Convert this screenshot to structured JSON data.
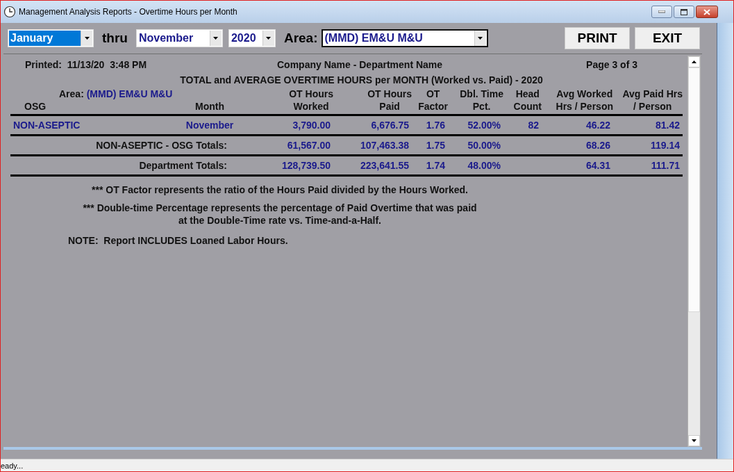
{
  "window": {
    "title": "Management Analysis Reports - Overtime Hours per Month"
  },
  "filters": {
    "from_month": {
      "value": "January",
      "focused": true
    },
    "thru_label": "thru",
    "to_month": {
      "value": "November",
      "focused": false
    },
    "year": {
      "value": "2020",
      "focused": false
    },
    "area_label": "Area:",
    "area": {
      "value": "(MMD) EM&U M&U",
      "focused": false
    }
  },
  "buttons": [
    "PRINT",
    "EXIT"
  ],
  "report": {
    "printed_label": "Printed:",
    "printed_value": "11/13/20  3:48 PM",
    "company": "Company Name - Department Name",
    "page": "Page 3 of 3",
    "title": "TOTAL and AVERAGE OVERTIME HOURS per MONTH (Worked vs. Paid) - 2020",
    "area_label": "Area:",
    "area_value": "(MMD) EM&U M&U",
    "columns": [
      [
        "OSG"
      ],
      [
        "Month"
      ],
      [
        "OT Hours",
        "Worked"
      ],
      [
        "OT Hours",
        "Paid"
      ],
      [
        "OT",
        "Factor"
      ],
      [
        "Dbl. Time",
        "Pct."
      ],
      [
        "Head",
        "Count"
      ],
      [
        "Avg Worked",
        "Hrs / Person"
      ],
      [
        "Avg Paid Hrs",
        "/ Person"
      ]
    ],
    "rows": [
      {
        "osg": "NON-ASEPTIC",
        "month": "November",
        "ot_hours_worked": "3,790.00",
        "ot_hours_paid": "6,676.75",
        "ot_factor": "1.76",
        "dbl_time_pct": "52.00%",
        "head_count": "82",
        "avg_worked": "46.22",
        "avg_paid": "81.42"
      }
    ],
    "totals": [
      {
        "label": "NON-ASEPTIC - OSG Totals:",
        "ot_hours_worked": "61,567.00",
        "ot_hours_paid": "107,463.38",
        "ot_factor": "1.75",
        "dbl_time_pct": "50.00%",
        "avg_worked": "68.26",
        "avg_paid": "119.14"
      },
      {
        "label": "Department Totals:",
        "ot_hours_worked": "128,739.50",
        "ot_hours_paid": "223,641.55",
        "ot_factor": "1.74",
        "dbl_time_pct": "48.00%",
        "avg_worked": "64.31",
        "avg_paid": "111.71"
      }
    ],
    "footnotes": [
      "*** OT Factor represents the ratio of the Hours Paid divided by the Hours Worked.",
      "*** Double-time Percentage represents the percentage of Paid Overtime that was paid at the Double-Time rate vs. Time-and-a-Half."
    ],
    "note": "NOTE:  Report INCLUDES Loaned Labor Hours."
  },
  "status_bar": "eady..."
}
